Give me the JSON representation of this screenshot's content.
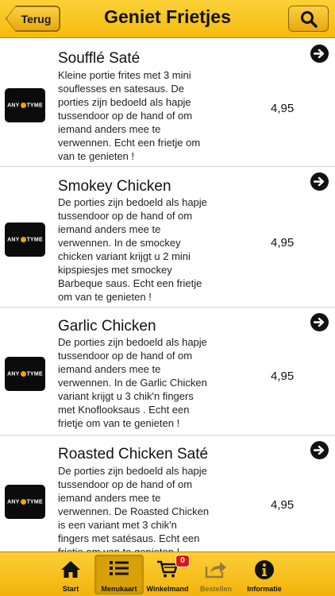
{
  "header": {
    "back_label": "Terug",
    "title": "Geniet Frietjes"
  },
  "logo_text": "ANYTYME",
  "items": [
    {
      "title": "Soufflé Saté",
      "desc_lines": [
        "Kleine portie frites met 3 mini",
        "souflesses en satesaus. De",
        "porties zijn bedoeld als hapje",
        "tussendoor op de hand of om",
        "iemand anders mee te",
        "verwennen. Echt een frietje om",
        "van te genieten !"
      ],
      "price": "4,95"
    },
    {
      "title": "Smokey Chicken",
      "desc_lines": [
        "De porties zijn bedoeld als hapje",
        "tussendoor op de hand of om",
        "iemand anders mee te",
        "verwennen. In de smockey",
        "chicken variant krijgt u 2 mini",
        "kipspiesjes met smockey",
        "Barbeque saus. Echt een frietje",
        "om van te genieten !"
      ],
      "price": "4,95"
    },
    {
      "title": "Garlic Chicken",
      "desc_lines": [
        "De porties zijn bedoeld als hapje",
        "tussendoor op de hand of om",
        "iemand anders mee te",
        "verwennen. In de Garlic Chicken",
        "variant krijgt u 3 chik'n fingers",
        "met Knoflooksaus . Echt een",
        "frietje om van te genieten !"
      ],
      "price": "4,95"
    },
    {
      "title": "Roasted Chicken Saté",
      "desc_lines": [
        "De porties zijn bedoeld als hapje",
        "tussendoor op de hand of om",
        "iemand anders mee te",
        "verwennen. De Roasted Chicken",
        "is een variant met 3 chik'n",
        "fingers met satésaus. Echt een",
        "frietje om van te genieten !"
      ],
      "price": "4,95"
    }
  ],
  "tabbar": {
    "tabs": [
      {
        "label": "Start",
        "icon": "home-icon"
      },
      {
        "label": "Menukaart",
        "icon": "list-icon"
      },
      {
        "label": "Winkelmand",
        "icon": "cart-icon",
        "badge": "0"
      },
      {
        "label": "Bestellen",
        "icon": "share-icon"
      },
      {
        "label": "Informatie",
        "icon": "info-icon"
      }
    ],
    "active_index": 1
  },
  "colors": {
    "accent": "#f5bb0d",
    "badge": "#e01616"
  }
}
